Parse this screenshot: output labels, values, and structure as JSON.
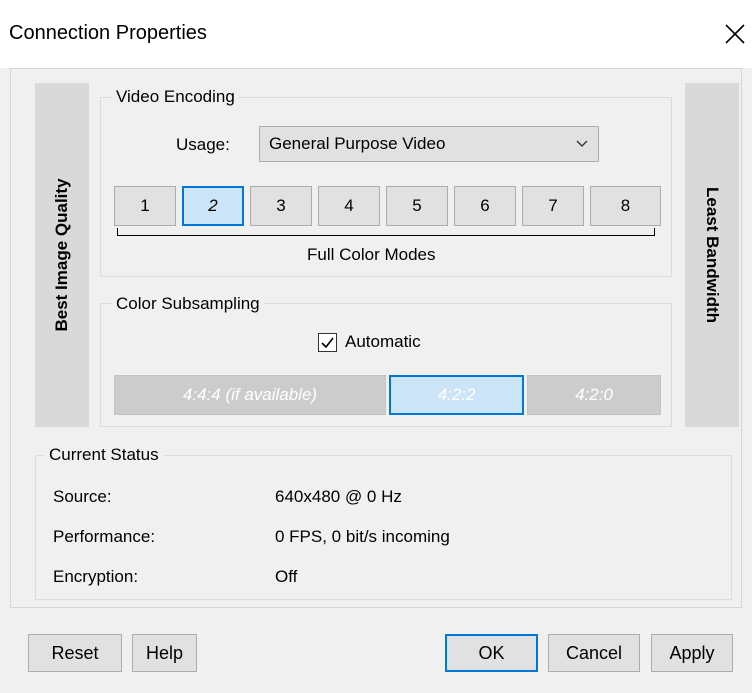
{
  "window": {
    "title": "Connection Properties",
    "close_icon": "close-icon"
  },
  "side_labels": {
    "left": "Best Image Quality",
    "right": "Least Bandwidth"
  },
  "video_encoding": {
    "group_label": "Video Encoding",
    "usage_label": "Usage:",
    "usage_value": "General Purpose Video",
    "modes": [
      "1",
      "2",
      "3",
      "4",
      "5",
      "6",
      "7",
      "8"
    ],
    "selected_mode": "2",
    "modes_caption": "Full Color Modes"
  },
  "color_subsampling": {
    "group_label": "Color Subsampling",
    "automatic_label": "Automatic",
    "automatic_checked": true,
    "options": [
      "4:4:4 (if available)",
      "4:2:2",
      "4:2:0"
    ],
    "selected_option": "4:2:2"
  },
  "current_status": {
    "group_label": "Current Status",
    "rows": [
      {
        "label": "Source:",
        "value": "640x480 @ 0 Hz"
      },
      {
        "label": "Performance:",
        "value": "0 FPS, 0 bit/s incoming"
      },
      {
        "label": "Encryption:",
        "value": "Off"
      }
    ]
  },
  "buttons": {
    "reset": "Reset",
    "help": "Help",
    "ok": "OK",
    "cancel": "Cancel",
    "apply": "Apply"
  },
  "colors": {
    "accent": "#0078d7",
    "selected_fill": "#cce4f7",
    "panel_gray": "#d9d9d9",
    "disabled_gray": "#cccccc"
  }
}
